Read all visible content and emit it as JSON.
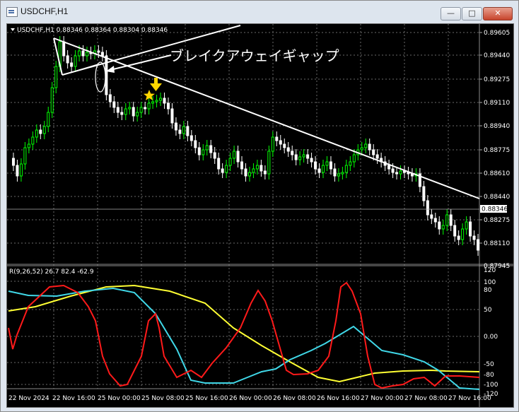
{
  "window": {
    "title": "USDCHF,H1",
    "buttons": {
      "minimize": "—",
      "maximize": "□",
      "close": "✕"
    }
  },
  "main_chart": {
    "symbol_info": "USDCHF,H1  0.88346 0.88364 0.88304 0.88346",
    "price_ticks": [
      "0.89605",
      "0.89440",
      "0.89275",
      "0.89110",
      "0.88940",
      "0.88775",
      "0.88610",
      "0.88440",
      "0.88275",
      "0.88110",
      "0.87945"
    ],
    "current_price": "0.88346",
    "annotation": "ブレイクアウェイギャップ",
    "colors": {
      "up": "#00ff00",
      "down": "#ffffff",
      "line": "#ffffff",
      "arrow": "#ffd700",
      "star": "#ffd700"
    }
  },
  "indicator": {
    "label": "R(9,26,52) 26.7 82.4 -62.9",
    "ticks": [
      "120",
      "100",
      "80",
      "50",
      "0.00",
      "-50",
      "-80",
      "-100",
      "-120"
    ],
    "colors": {
      "red": "#ff1a1a",
      "cyan": "#40d8e8",
      "yellow": "#ffff33"
    }
  },
  "x_labels": [
    "22 Nov 2024",
    "22 Nov 16:00",
    "25 Nov 00:00",
    "25 Nov 08:00",
    "25 Nov 16:00",
    "26 Nov 00:00",
    "26 Nov 08:00",
    "26 Nov 16:00",
    "27 Nov 00:00",
    "27 Nov 08:00",
    "27 Nov 16:00"
  ]
}
